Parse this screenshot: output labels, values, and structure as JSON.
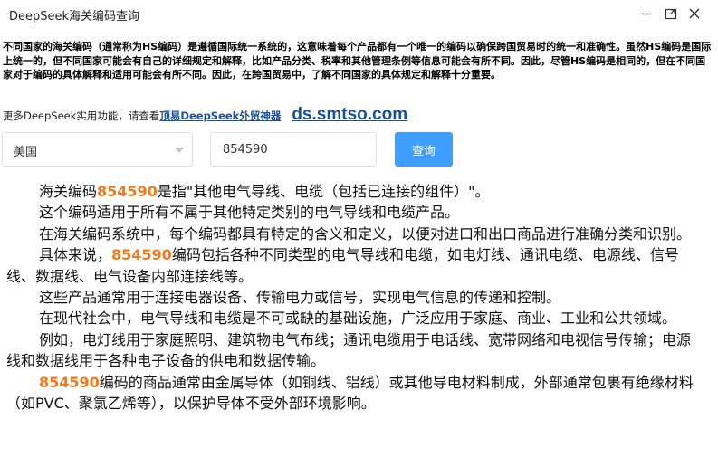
{
  "window": {
    "title": "DeepSeek海关编码查询",
    "minimize_icon": "minimize-icon",
    "maximize_icon": "maximize-icon",
    "close_icon": "close-icon"
  },
  "intro": "不同国家的海关编码（通常称为HS编码）是遵循国际统一系统的，这意味着每个产品都有一个唯一的编码以确保跨国贸易时的统一和准确性。虽然HS编码是国际上统一的，但不同国家可能会有自己的详细规定和解释，比如产品分类、税率和其他管理条例等信息可能会有所不同。因此，尽管HS编码是相同的，但在不同国家对于编码的具体解释和适用可能会有所不同。因此，在跨国贸易中，了解不同国家的具体规定和解释十分重要。",
  "promo": {
    "text": "更多DeepSeek实用功能，请查看",
    "link": "顶易DeepSeek外贸神器",
    "domain": "ds.smtso.com"
  },
  "query": {
    "country": "美国",
    "code": "854590",
    "search_label": "查询"
  },
  "result": {
    "code": "854590",
    "p1_before": "海关编码",
    "p1_after": "是指\"其他电气导线、电缆（包括已连接的组件）\"。",
    "p2": "这个编码适用于所有不属于其他特定类别的电气导线和电缆产品。",
    "p3": "在海关编码系统中，每个编码都具有特定的含义和定义，以便对进口和出口商品进行准确分类和识别。",
    "p4_before": "具体来说，",
    "p4_after": "编码包括各种不同类型的电气导线和电缆，如电灯线、通讯电缆、电源线、信号线、数据线、电气设备内部连接线等。",
    "p5": "这些产品通常用于连接电器设备、传输电力或信号，实现电气信息的传递和控制。",
    "p6": "在现代社会中，电气导线和电缆是不可或缺的基础设施，广泛应用于家庭、商业、工业和公共领域。",
    "p7": "例如，电灯线用于家庭照明、建筑物电气布线；通讯电缆用于电话线、宽带网络和电视信号传输；电源线和数据线用于各种电子设备的供电和数据传输。",
    "p8_after": "编码的商品通常由金属导体（如铜线、铝线）或其他导电材料制成，外部通常包裹有绝缘材料（如PVC、聚氯乙烯等），以保护导体不受外部环境影响。"
  }
}
